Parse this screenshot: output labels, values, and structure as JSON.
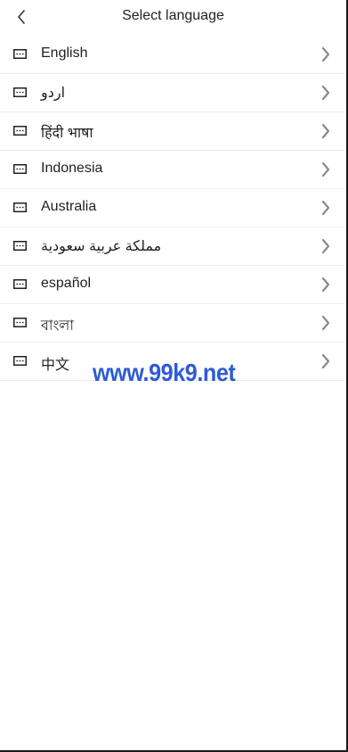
{
  "header": {
    "title": "Select language"
  },
  "languages": [
    {
      "label": "English"
    },
    {
      "label": "اردو"
    },
    {
      "label": "हिंदी भाषा"
    },
    {
      "label": "Indonesia"
    },
    {
      "label": "Australia"
    },
    {
      "label": "مملكة عربية سعودية"
    },
    {
      "label": "español"
    },
    {
      "label": "বাংলা"
    },
    {
      "label": "中文"
    }
  ],
  "watermark": {
    "text": "www.99k9.net",
    "color": "#2e5bd6"
  },
  "icons": {
    "back": "chevron-left-icon",
    "language": "keyboard-icon",
    "row_arrow": "chevron-right-icon"
  },
  "colors": {
    "text": "#222222",
    "divider": "#eeeeee",
    "chevron": "#8a8a8a"
  }
}
